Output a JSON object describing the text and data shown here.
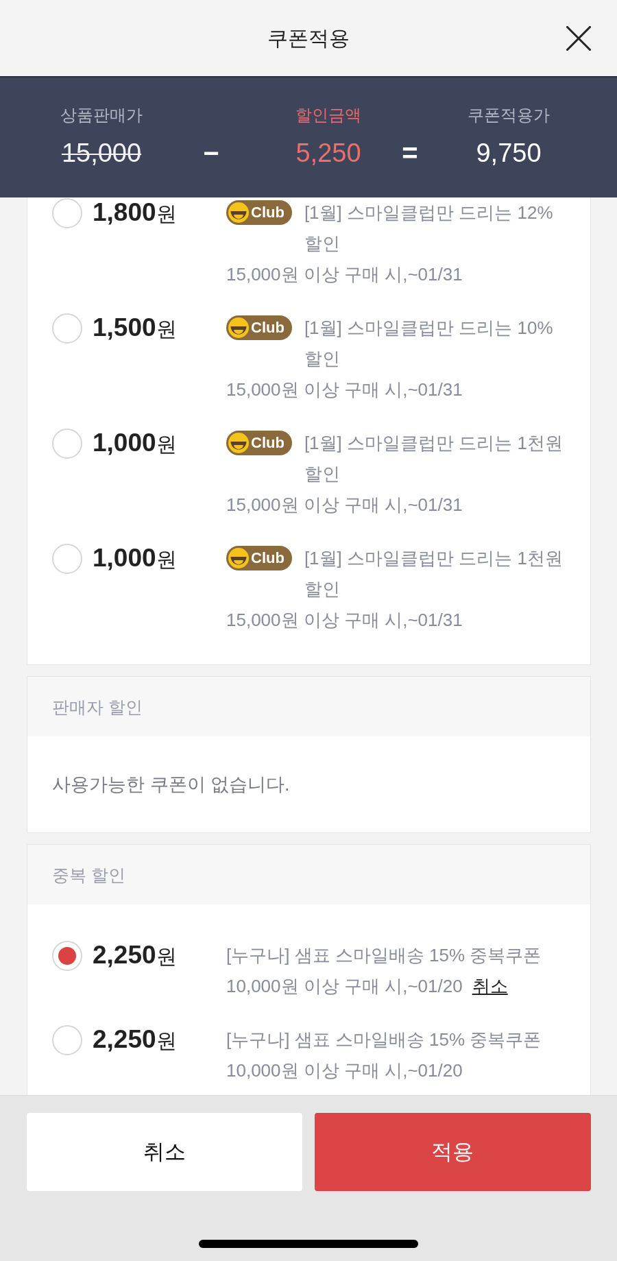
{
  "header": {
    "title": "쿠폰적용"
  },
  "summary": {
    "columns": [
      {
        "kind": "original",
        "label": "상품판매가",
        "value": "15,000"
      },
      {
        "kind": "discount",
        "label": "할인금액",
        "value": "5,250"
      },
      {
        "kind": "final",
        "label": "쿠폰적용가",
        "value": "9,750"
      }
    ],
    "operators": [
      "−",
      "="
    ]
  },
  "sections": [
    {
      "coupons": [
        {
          "selected": false,
          "amount": "**1,800**원",
          "badge": "Club",
          "description": "[1월] 스마일클럽만 드리는 12% 할인",
          "condition": "15,000원 이상 구매 시,~01/31"
        },
        {
          "selected": false,
          "amount": "**1,500**원",
          "badge": "Club",
          "description": "[1월] 스마일클럽만 드리는 10% 할인",
          "condition": "15,000원 이상 구매 시,~01/31"
        },
        {
          "selected": false,
          "amount": "**1,000**원",
          "badge": "Club",
          "description": "[1월] 스마일클럽만 드리는 1천원 할인",
          "condition": "15,000원 이상 구매 시,~01/31"
        },
        {
          "selected": false,
          "amount": "**1,000**원",
          "badge": "Club",
          "description": "[1월] 스마일클럽만 드리는 1천원 할인",
          "condition": "15,000원 이상 구매 시,~01/31"
        }
      ]
    },
    {
      "title": "판매자 할인",
      "empty_message": "사용가능한 쿠폰이 없습니다."
    },
    {
      "title": "중복 할인",
      "coupons": [
        {
          "selected": true,
          "amount": "**2,250**원",
          "description": "[누구나] 샘표 스마일배송 15% 중복쿠폰",
          "condition": "10,000원 이상 구매 시,~01/20",
          "cancel_link": "취소"
        },
        {
          "selected": false,
          "amount": "**2,250**원",
          "description": "[누구나] 샘표 스마일배송 15% 중복쿠폰",
          "condition": "10,000원 이상 구매 시,~01/20"
        }
      ]
    }
  ],
  "footer": {
    "buttons": [
      {
        "kind": "secondary",
        "label": "취소"
      },
      {
        "kind": "primary",
        "label": "적용"
      }
    ]
  }
}
